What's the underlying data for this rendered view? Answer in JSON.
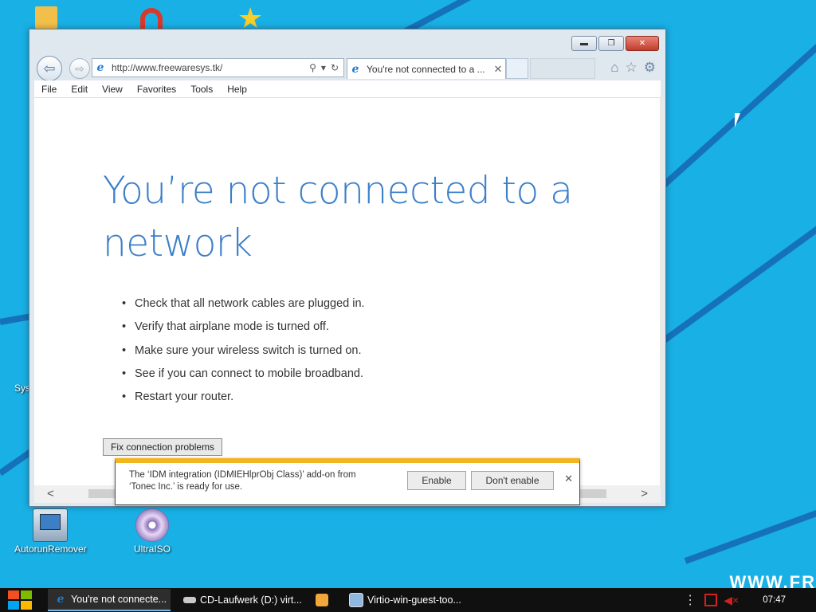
{
  "desktop": {
    "icons": [
      {
        "label": "AutorunRemover",
        "icon": "autorun-remover-icon"
      },
      {
        "label": "UltraISO",
        "icon": "disc-icon"
      },
      {
        "label": "Sys",
        "icon": "system-icon"
      }
    ],
    "watermark": "WWW.FR"
  },
  "browser": {
    "address": "http://www.freewaresys.tk/",
    "tab_title": "You're not connected to a ...",
    "menu": [
      "File",
      "Edit",
      "View",
      "Favorites",
      "Tools",
      "Help"
    ],
    "window_controls": {
      "minimize": "▬",
      "maximize": "❐",
      "close": "✕"
    }
  },
  "page": {
    "headline": "You’re not connected to a network",
    "tips": [
      "Check that all network cables are plugged in.",
      "Verify that airplane mode is turned off.",
      "Make sure your wireless switch is turned on.",
      "See if you can connect to mobile broadband.",
      "Restart your router."
    ],
    "fix_button": "Fix connection problems"
  },
  "notification": {
    "message_line1": "The ‘IDM integration (IDMIEHlprObj Class)’ add-on from",
    "message_line2": "‘Tonec Inc.’ is ready for use.",
    "enable_label": "Enable",
    "dont_enable_label": "Don't enable",
    "close": "✕",
    "accent_color": "#f3b623"
  },
  "taskbar": {
    "items": [
      {
        "label": "You're not connecte...",
        "icon": "ie-icon",
        "active": true
      },
      {
        "label": "CD-Laufwerk (D:) virt...",
        "icon": "drive-icon",
        "active": false
      },
      {
        "label": "",
        "icon": "media-player-icon",
        "active": false
      },
      {
        "label": "Virtio-win-guest-too...",
        "icon": "installer-icon",
        "active": false
      }
    ],
    "clock": "07:47"
  }
}
